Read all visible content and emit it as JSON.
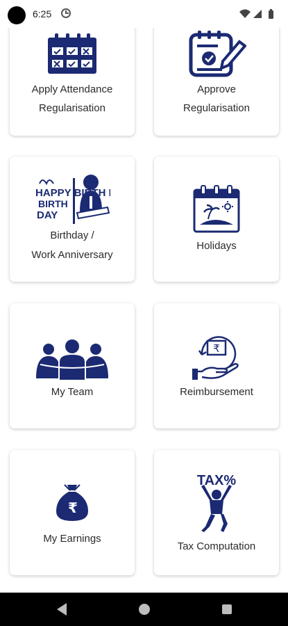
{
  "status_bar": {
    "time": "6:25"
  },
  "colors": {
    "icon_navy": "#1b2a72",
    "text": "#2b2b2b",
    "card_bg": "#ffffff",
    "nav_bar": "#000000"
  },
  "tiles": [
    {
      "label_line1": "Apply Attendance",
      "label_line2": "Regularisation",
      "icon": "calendar-grid-icon"
    },
    {
      "label_line1": "Approve",
      "label_line2": "Regularisation",
      "icon": "checklist-pencil-icon"
    },
    {
      "label_line1": "Birthday /",
      "label_line2": "Work Anniversary",
      "icon": "birthday-anniversary-icon",
      "icon_text": "HAPPY BIRTH DAY"
    },
    {
      "label_line1": "Holidays",
      "icon": "holiday-calendar-icon"
    },
    {
      "label_line1": "My Team",
      "icon": "team-icon"
    },
    {
      "label_line1": "Reimbursement",
      "icon": "rupee-hand-icon"
    },
    {
      "label_line1": "My Earnings",
      "icon": "money-bag-icon"
    },
    {
      "label_line1": "Tax Computation",
      "icon": "tax-person-icon",
      "icon_text": "TAX%"
    }
  ],
  "nav": {
    "back": "back-icon",
    "home": "home-icon",
    "recents": "recents-icon"
  }
}
